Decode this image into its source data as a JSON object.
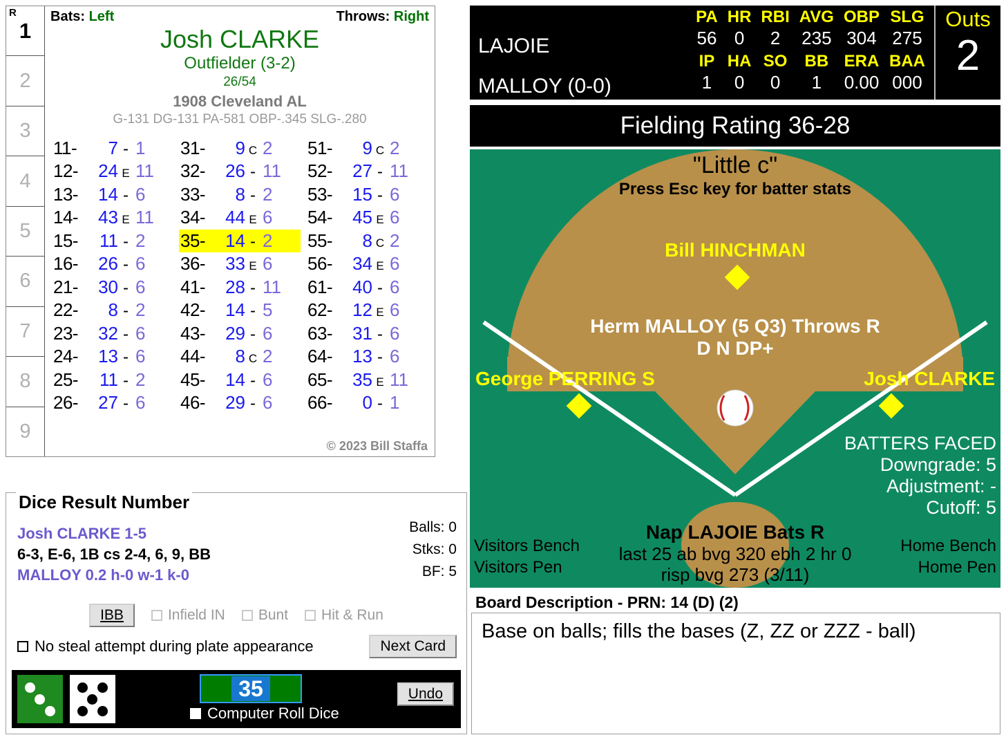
{
  "card": {
    "r_label": "R",
    "innings": [
      "1",
      "2",
      "3",
      "4",
      "5",
      "6",
      "7",
      "8",
      "9"
    ],
    "bats_label": "Bats:",
    "bats_value": "Left",
    "throws_label": "Throws:",
    "throws_value": "Right",
    "player_name": "Josh CLARKE",
    "position": "Outfielder (3-2)",
    "card_number": "26/54",
    "team": "1908 Cleveland AL",
    "stat_line": "G-131 DG-131 PA-581 OBP-.345 SLG-.280",
    "copyright": "© 2023 Bill Staffa",
    "entries": [
      {
        "key": "11-",
        "res": "7",
        "mid": "-",
        "num": "1",
        "hl": false
      },
      {
        "key": "12-",
        "res": "24",
        "mid": "E",
        "num": "11",
        "hl": false
      },
      {
        "key": "13-",
        "res": "14",
        "mid": "-",
        "num": "6",
        "hl": false
      },
      {
        "key": "14-",
        "res": "43",
        "mid": "E",
        "num": "11",
        "hl": false
      },
      {
        "key": "15-",
        "res": "11",
        "mid": "-",
        "num": "2",
        "hl": false
      },
      {
        "key": "16-",
        "res": "26",
        "mid": "-",
        "num": "6",
        "hl": false
      },
      {
        "key": "21-",
        "res": "30",
        "mid": "-",
        "num": "6",
        "hl": false
      },
      {
        "key": "22-",
        "res": "8",
        "mid": "-",
        "num": "2",
        "hl": false
      },
      {
        "key": "23-",
        "res": "32",
        "mid": "-",
        "num": "6",
        "hl": false
      },
      {
        "key": "24-",
        "res": "13",
        "mid": "-",
        "num": "6",
        "hl": false
      },
      {
        "key": "25-",
        "res": "11",
        "mid": "-",
        "num": "2",
        "hl": false
      },
      {
        "key": "26-",
        "res": "27",
        "mid": "-",
        "num": "6",
        "hl": false
      },
      {
        "key": "31-",
        "res": "9",
        "mid": "C",
        "num": "2",
        "hl": false
      },
      {
        "key": "32-",
        "res": "26",
        "mid": "-",
        "num": "11",
        "hl": false
      },
      {
        "key": "33-",
        "res": "8",
        "mid": "-",
        "num": "2",
        "hl": false
      },
      {
        "key": "34-",
        "res": "44",
        "mid": "E",
        "num": "6",
        "hl": false
      },
      {
        "key": "35-",
        "res": "14",
        "mid": "-",
        "num": "2",
        "hl": true
      },
      {
        "key": "36-",
        "res": "33",
        "mid": "E",
        "num": "6",
        "hl": false
      },
      {
        "key": "41-",
        "res": "28",
        "mid": "-",
        "num": "11",
        "hl": false
      },
      {
        "key": "42-",
        "res": "14",
        "mid": "-",
        "num": "5",
        "hl": false
      },
      {
        "key": "43-",
        "res": "29",
        "mid": "-",
        "num": "6",
        "hl": false
      },
      {
        "key": "44-",
        "res": "8",
        "mid": "C",
        "num": "2",
        "hl": false
      },
      {
        "key": "45-",
        "res": "14",
        "mid": "-",
        "num": "6",
        "hl": false
      },
      {
        "key": "46-",
        "res": "29",
        "mid": "-",
        "num": "6",
        "hl": false
      },
      {
        "key": "51-",
        "res": "9",
        "mid": "C",
        "num": "2",
        "hl": false
      },
      {
        "key": "52-",
        "res": "27",
        "mid": "-",
        "num": "11",
        "hl": false
      },
      {
        "key": "53-",
        "res": "15",
        "mid": "-",
        "num": "6",
        "hl": false
      },
      {
        "key": "54-",
        "res": "45",
        "mid": "E",
        "num": "6",
        "hl": false
      },
      {
        "key": "55-",
        "res": "8",
        "mid": "C",
        "num": "2",
        "hl": false
      },
      {
        "key": "56-",
        "res": "34",
        "mid": "E",
        "num": "6",
        "hl": false
      },
      {
        "key": "61-",
        "res": "40",
        "mid": "-",
        "num": "6",
        "hl": false
      },
      {
        "key": "62-",
        "res": "12",
        "mid": "E",
        "num": "6",
        "hl": false
      },
      {
        "key": "63-",
        "res": "31",
        "mid": "-",
        "num": "6",
        "hl": false
      },
      {
        "key": "64-",
        "res": "13",
        "mid": "-",
        "num": "6",
        "hl": false
      },
      {
        "key": "65-",
        "res": "35",
        "mid": "E",
        "num": "11",
        "hl": false
      },
      {
        "key": "66-",
        "res": "0",
        "mid": "-",
        "num": "1",
        "hl": false
      }
    ]
  },
  "drn": {
    "legend": "Dice Result Number",
    "line_batter": "Josh CLARKE  1-5",
    "line_results": "6-3, E-6, 1B cs 2-4, 6, 9, BB",
    "line_pitcher": "MALLOY  0.2  h-0  w-1  k-0",
    "balls": "Balls: 0",
    "strikes": "Stks: 0",
    "bf": "BF: 5",
    "ibb_label": "IBB",
    "infield_in_label": "Infield IN",
    "bunt_label": "Bunt",
    "hit_and_run_label": "Hit & Run",
    "no_steal_label": "No steal attempt during plate appearance",
    "next_card_label": "Next Card",
    "roll_value": "35",
    "computer_roll_label": "Computer Roll Dice",
    "undo_label": "Undo",
    "die_green_value": 3,
    "die_white_value": 5
  },
  "scoreboard": {
    "batter_name": "LAJOIE",
    "pitcher_name": "MALLOY (0-0)",
    "batter_headers": [
      "PA",
      "HR",
      "RBI",
      "AVG",
      "OBP",
      "SLG"
    ],
    "batter_values": [
      "56",
      "0",
      "2",
      "235",
      "304",
      "275"
    ],
    "pitcher_headers": [
      "IP",
      "HA",
      "SO",
      "BB",
      "ERA",
      "BAA"
    ],
    "pitcher_values": [
      "1",
      "0",
      "0",
      "1",
      "0.00",
      "000"
    ],
    "outs_label": "Outs",
    "outs_value": "2",
    "fielding_rating": "Fielding Rating 36-28"
  },
  "field": {
    "little_c": "\"Little c\"",
    "esc_hint": "Press Esc key for batter stats",
    "center_fielder": "Bill HINCHMAN",
    "pitcher_line1": "Herm MALLOY (5 Q3) Throws R",
    "pitcher_line2": "D N DP+",
    "left_fielder": "George PERRING S",
    "right_fielder": "Josh CLARKE",
    "batters_faced_title": "BATTERS FACED",
    "downgrade": "Downgrade: 5",
    "adjustment": "Adjustment: -",
    "cutoff": "Cutoff: 5",
    "batter_line1": "Nap LAJOIE Bats R",
    "batter_line2": "last 25 ab bvg 320 ebh 2 hr 0",
    "batter_line3": "risp bvg 273 (3/11)",
    "visitors_bench": "Visitors Bench",
    "visitors_pen": "Visitors Pen",
    "home_bench": "Home Bench",
    "home_pen": "Home Pen"
  },
  "board": {
    "label": "Board Description - PRN: 14 (D) (2)",
    "description": "Base on balls; fills the bases (Z, ZZ or ZZZ - ball)"
  },
  "colors": {
    "grass": "#0f8a60",
    "dirt": "#b8904a",
    "accent_yellow": "#ffff00",
    "highlight": "#ffff00",
    "result_blue": "#1a1aee",
    "number_purple": "#7b68d8",
    "green_text": "#117711"
  }
}
